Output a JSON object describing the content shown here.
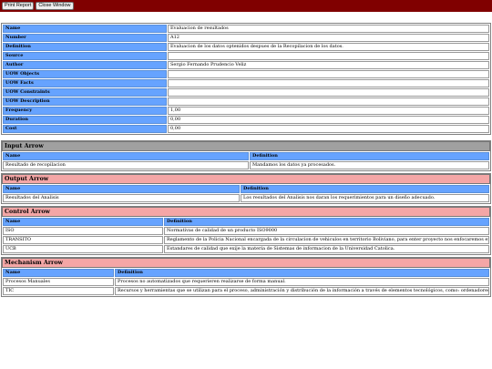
{
  "toolbar": {
    "print_label": "Print Report",
    "close_label": "Close Window"
  },
  "properties": [
    {
      "key": "Name",
      "value": "Evaluacion de resultados"
    },
    {
      "key": "Number",
      "value": "A12"
    },
    {
      "key": "Definition",
      "value": "Evaluacion de los datos optenidos despues de la Recopilacion de los datos."
    },
    {
      "key": "Source",
      "value": ""
    },
    {
      "key": "Author",
      "value": "Sergio Fernando Prudencio Veliz"
    },
    {
      "key": "UOW Objects",
      "value": ""
    },
    {
      "key": "UOW Facts",
      "value": ""
    },
    {
      "key": "UOW Constraints",
      "value": ""
    },
    {
      "key": "UOW Description",
      "value": ""
    },
    {
      "key": "Frequency",
      "value": "1,00"
    },
    {
      "key": "Duration",
      "value": "0,00"
    },
    {
      "key": "Cost",
      "value": "0,00"
    }
  ],
  "input_arrow": {
    "title": "Input Arrow",
    "col_name": "Name",
    "col_def": "Definition",
    "rows": [
      {
        "name": "Resultado de recopilacion",
        "definition": "Mandamos los datos ya procesados."
      }
    ]
  },
  "output_arrow": {
    "title": "Output Arrow",
    "col_name": "Name",
    "col_def": "Definition",
    "rows": [
      {
        "name": "Resultados del Analisis",
        "definition": "Los resultados del Analisis nos daran los requerimientos para un diseño adecuado."
      }
    ]
  },
  "control_arrow": {
    "title": "Control Arrow",
    "col_name": "Name",
    "col_def": "Definition",
    "rows": [
      {
        "name": "ISO",
        "definition": "Normativas de calidad de un producto ISO9000"
      },
      {
        "name": "TRANSITO",
        "definition": "Reglamento de la Policia Nacional encargada de la circulacion de vehiculos en territorio Boliviano, para enter proyecto nos enfocaremos en la zona de La Paz."
      },
      {
        "name": "UCB",
        "definition": "Estandares de calidad que exije la materia de Sistemas de informacion de la Universidad Catolica."
      }
    ]
  },
  "mechanism_arrow": {
    "title": "Mechanism Arrow",
    "col_name": "Name",
    "col_def": "Definition",
    "rows": [
      {
        "name": "Procesos Manuales",
        "definition": "Procesos no automatizados que requerieren realizarse de forma manual."
      },
      {
        "name": "TIC",
        "definition": "Recursos y herramientas que se utilizan para el proceso, administración y distribución de la información a través de elementos tecnológicos, como: ordenadores, teléfonos, televisores, etc."
      }
    ]
  },
  "colors": {
    "toolbar": "#800000",
    "header_blue": "#66a3ff",
    "input_gray": "#a0a0a0",
    "section_pink": "#f4a6a6"
  }
}
